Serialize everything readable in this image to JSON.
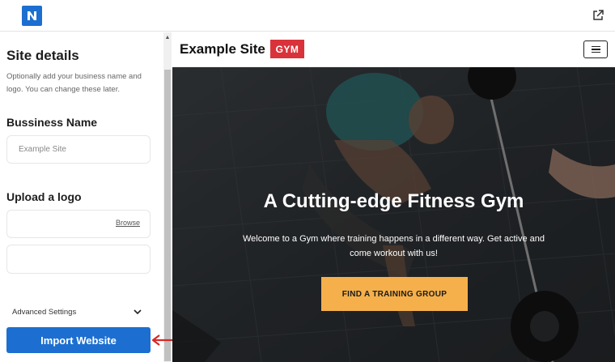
{
  "app": {
    "logo_letter": "N"
  },
  "sidebar": {
    "title": "Site details",
    "description": "Optionally add your business name and logo. You can change these later.",
    "business_name_label": "Bussiness Name",
    "business_name_placeholder": "Example Site",
    "upload_logo_label": "Upload a logo",
    "browse_label": "Browse",
    "advanced_settings_label": "Advanced Settings",
    "import_button_label": "Import Website"
  },
  "preview": {
    "site_name": "Example Site",
    "badge": "GYM",
    "hero_title": "A Cutting-edge Fitness Gym",
    "hero_text": "Welcome to a Gym where training happens in a different way. Get active and come workout with us!",
    "cta_label": "FIND A TRAINING GROUP"
  },
  "colors": {
    "accent_blue": "#1c6fd0",
    "badge_red": "#d9323a",
    "cta_orange": "#f5b04b",
    "arrow_red": "#d62828"
  }
}
